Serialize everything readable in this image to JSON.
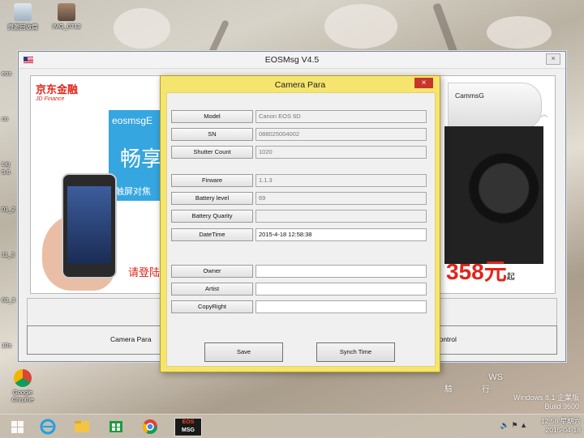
{
  "desktop": {
    "icons": [
      {
        "label": "資源回收筒",
        "icon": "recycle-bin-icon"
      },
      {
        "label": "IMG_0712",
        "icon": "image-file-icon"
      }
    ],
    "edge_labels": [
      "eos",
      "co",
      "Lig",
      "5.6",
      "01_2",
      "11_2",
      "68_3",
      "10s"
    ],
    "chrome_icon": {
      "label": "Google Chrome"
    },
    "watermark": {
      "edition": "Windows 8.1 企業版",
      "build": "Build 9600",
      "partial_text": "WS",
      "partial_text2": "驗",
      "partial_text3": "行"
    }
  },
  "main_window": {
    "title": "EOSMsg V4.5",
    "close_label": "×",
    "banner": {
      "jd_logo": "京东金融",
      "jd_sub": "JD Finance",
      "blue_t1": "eosmsgE",
      "blue_t2": "畅享",
      "blue_t3": "触屏对焦",
      "promo": "请登陆",
      "cam_brand": "CammsG",
      "price": "358元",
      "price_suffix": "起"
    },
    "bottom_buttons": {
      "camera_para": "Camera Para",
      "remote_control": "te Control"
    }
  },
  "dialog": {
    "title": "Camera Para",
    "close_label": "×",
    "fields": [
      {
        "label": "Model",
        "value": "Canon EOS 6D",
        "editable": false
      },
      {
        "label": "SN",
        "value": "088025004002",
        "editable": false
      },
      {
        "label": "Shutter Count",
        "value": "1020",
        "editable": false
      },
      {
        "label": "Firware",
        "value": "1.1.3",
        "editable": false
      },
      {
        "label": "Battery level",
        "value": "69",
        "editable": false
      },
      {
        "label": "Battery Quarity",
        "value": "",
        "editable": false
      },
      {
        "label": "DateTime",
        "value": "2015-4-18 12:58:38",
        "editable": true
      },
      {
        "label": "Owner",
        "value": "",
        "editable": true
      },
      {
        "label": "Artist",
        "value": "",
        "editable": true
      },
      {
        "label": "CopyRight",
        "value": "",
        "editable": true
      }
    ],
    "save_label": "Save",
    "synch_label": "Synch Time"
  },
  "taskbar": {
    "eos_label_top": "EOS",
    "eos_label_bottom": "MSG",
    "tray_symbols": "🔊 ⚑ ▲",
    "time": "12:58 星期六",
    "date": "2015-04-18"
  }
}
